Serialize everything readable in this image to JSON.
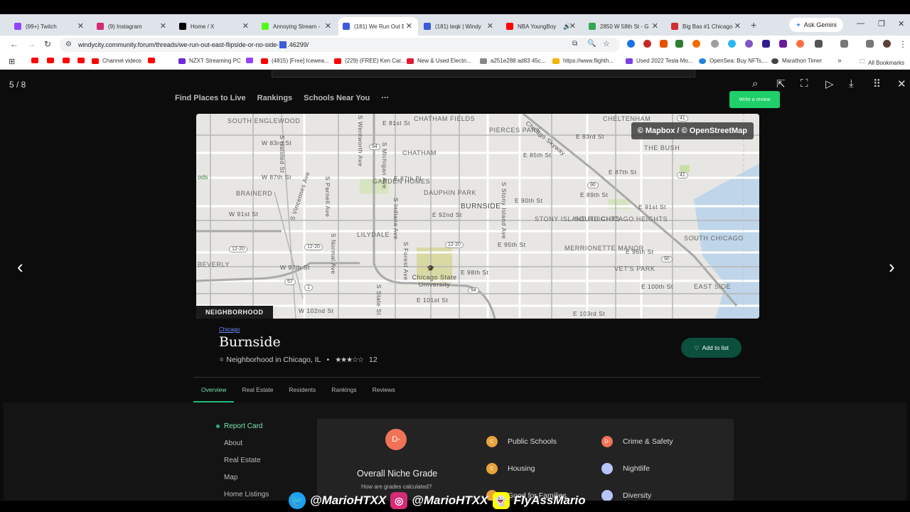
{
  "tabs": [
    {
      "label": "(99+) Twitch",
      "color": "#9146ff"
    },
    {
      "label": "(9) Instagram",
      "color": "#d62976"
    },
    {
      "label": "Home / X",
      "color": "#000000"
    },
    {
      "label": "Annoying Stream -",
      "color": "#53fc18"
    },
    {
      "label": "(181) We Run Out E",
      "color": "#3b5bdb"
    },
    {
      "label": "(181) teqk | Windy",
      "color": "#3b5bdb"
    },
    {
      "label": "NBA YoungBoy",
      "color": "#ff0000"
    },
    {
      "label": "2850 W 58th St - G",
      "color": "#34a853"
    },
    {
      "label": "Big Bas #1 Chicago",
      "color": "#d32f2f"
    }
  ],
  "ask_gemini": "Ask Gemini",
  "url": "windycity.community.forum/threads/we-run-out-east-flipside-or-no-side-",
  "url_tail": ".46299/",
  "bookmarks": [
    {
      "label": "",
      "color": "#ff0000"
    },
    {
      "label": "",
      "color": "#ff0000"
    },
    {
      "label": "",
      "color": "#ff0000"
    },
    {
      "label": "",
      "color": "#ff0000"
    },
    {
      "label": "Channel videos",
      "color": "#ff0000"
    },
    {
      "label": "",
      "color": "#ff0000"
    },
    {
      "label": "NZXT Streaming PC",
      "color": "#6a2bd9"
    },
    {
      "label": "",
      "color": "#9146ff"
    },
    {
      "label": "(4815) [Free] Icewea...",
      "color": "#ff0000"
    },
    {
      "label": "(229) (FREE) Ken Car...",
      "color": "#ff0000"
    },
    {
      "label": "New & Used Electri...",
      "color": "#e31937"
    },
    {
      "label": "a251e288 ad83 45c...",
      "color": "#888888"
    },
    {
      "label": "https://www.flighth...",
      "color": "#f4b400"
    },
    {
      "label": "Used 2022 Tesla Mo...",
      "color": "#7b3fe4"
    },
    {
      "label": "OpenSea: Buy NFTs,...",
      "color": "#2081e2"
    },
    {
      "label": "Marathon Timer",
      "color": "#444444"
    }
  ],
  "all_bookmarks": "All Bookmarks",
  "viewer": {
    "counter": "5 / 8"
  },
  "site_nav": [
    "Find Places to Live",
    "Rankings",
    "Schools Near You"
  ],
  "write_review": "Write a review",
  "map": {
    "credit": "© Mapbox / © OpenStreetMap",
    "tag": "NEIGHBORHOOD",
    "neighborhoods": [
      "SOUTH ENGLEWOOD",
      "CHATHAM FIELDS",
      "PIERCES PARK",
      "CHELTENHAM",
      "THE BUSH",
      "CHATHAM",
      "BRAINERD",
      "GARDEN HOMES",
      "DAUPHIN PARK",
      "BURNSIDE",
      "STONY ISLAND HEIGHTS",
      "SOUTH CHICAGO HEIGHTS",
      "SOUTH CHICAGO",
      "LILYDALE",
      "MERRIONETTE MANOR",
      "VET'S PARK",
      "EAST SIDE",
      "BEVERLY"
    ],
    "streets": [
      "W 83rd St",
      "E 81st St",
      "E 83rd St",
      "W 87th St",
      "E 87th Pl",
      "E 87th St",
      "E 85th St",
      "E 90th St",
      "E 89th St",
      "E 91st St",
      "W 91st St",
      "E 92nd St",
      "W 97th St",
      "E 95th St",
      "E 96th St",
      "E 98th St",
      "E 100th St",
      "E 101st St",
      "W 102nd St",
      "E 103rd St",
      "S Halsted St",
      "S Parnell Ave",
      "S Normal Ave",
      "S Vincennes Ave",
      "S Michigan Ave",
      "S Indiana Ave",
      "S Forest Ave",
      "S State St",
      "S Stony Island Ave",
      "S Wentworth Ave",
      "Chicago Skyway"
    ],
    "shields": [
      "94",
      "94",
      "12-20",
      "12-20",
      "12-20",
      "57",
      "1",
      "41",
      "41",
      "90",
      "90"
    ],
    "poi": "Chicago State University"
  },
  "neighborhood": {
    "city": "Chicago",
    "name": "Burnside",
    "meta": "Neighborhood in Chicago, IL",
    "stars": 3,
    "stars_max": 5,
    "review_count": "12"
  },
  "add_to_list": "Add to list",
  "subnav": [
    "Overview",
    "Real Estate",
    "Residents",
    "Rankings",
    "Reviews"
  ],
  "sidebar": [
    "About",
    "Real Estate",
    "Map",
    "Home Listings"
  ],
  "sidebar_active": "Report Card",
  "report_card": {
    "overall_grade": "D-",
    "overall_title": "Overall Niche Grade",
    "how_calc": "How are grades calculated?",
    "grades": [
      {
        "grade": "C",
        "label": "Public Schools",
        "color": "#e8a33d"
      },
      {
        "grade": "D-",
        "label": "Crime & Safety",
        "color": "#f07358"
      },
      {
        "grade": "C",
        "label": "Housing",
        "color": "#e8a33d"
      },
      {
        "grade": "",
        "label": "Nightlife",
        "color": "#b8c4ff"
      },
      {
        "grade": "",
        "label": "Good for Families",
        "color": "#e8a33d"
      },
      {
        "grade": "",
        "label": "Diversity",
        "color": "#b8c4ff"
      }
    ]
  },
  "social": {
    "twitter": "@MarioHTXX",
    "instagram": "@MarioHTXX",
    "snapchat": "FlyAssMario"
  }
}
